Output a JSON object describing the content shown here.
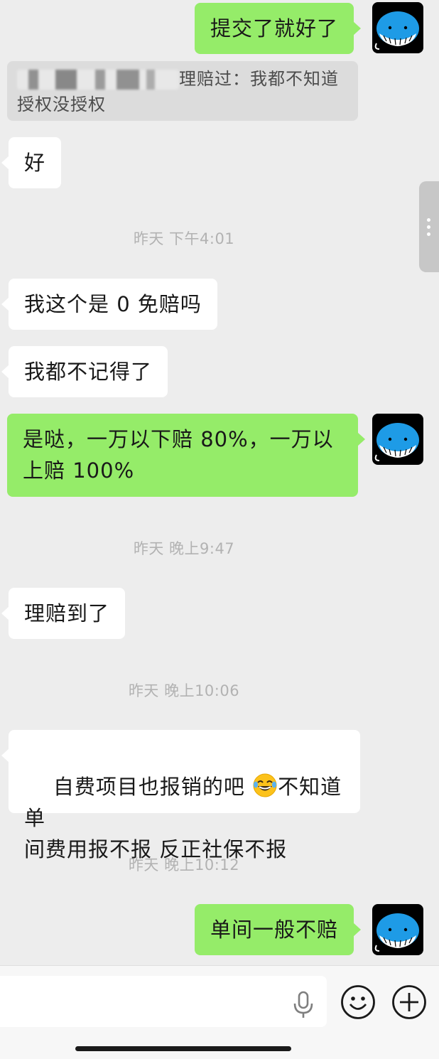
{
  "messages": {
    "m1": "提交了就好了",
    "quote_text": "理赔过：我都不知道",
    "quote_line2": "授权没授权",
    "m2": "好",
    "m3": "我这个是 0 免赔吗",
    "m4": "我都不记得了",
    "m5": "是哒，一万以下赔 80%，一万以\n上赔 100%",
    "m6": "理赔到了",
    "m7a": "自费项目也报销的吧 ",
    "m7b": "不知道单\n间费用报不报 反正社保不报",
    "m8": "单间一般不赔"
  },
  "timestamps": {
    "t1": "昨天 下午4:01",
    "t2": "昨天 晚上9:47",
    "t3": "昨天 晚上10:06",
    "t4": "昨天 晚上10:12"
  },
  "colors": {
    "background": "#ededed",
    "incoming_bubble": "#ffffff",
    "outgoing_bubble": "#95ec69",
    "avatar_whale": "#1e9be6"
  },
  "icons": {
    "avatar": "whale-avatar-icon",
    "mic": "microphone-icon",
    "emoji": "smiley-face-icon",
    "plus": "plus-circle-icon",
    "laugh": "tears-of-joy-emoji"
  }
}
